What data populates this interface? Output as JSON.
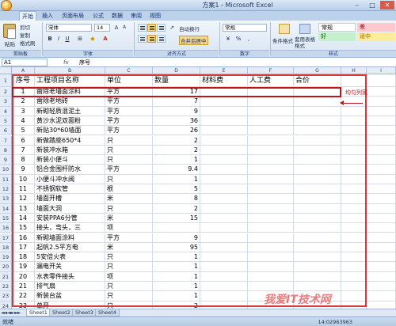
{
  "window": {
    "title": "方案1 - Microsoft Excel"
  },
  "ribbon_tabs": [
    "开始",
    "插入",
    "页面布局",
    "公式",
    "数据",
    "审阅",
    "视图"
  ],
  "clipboard": {
    "paste": "粘贴",
    "cut": "剪切",
    "copy": "复制",
    "format_painter": "格式刷",
    "label": "剪贴板"
  },
  "font": {
    "name": "宋体",
    "size": "14",
    "label": "字体"
  },
  "alignment": {
    "wrap": "自动换行",
    "merge": "合并后居中",
    "label": "对齐方式"
  },
  "number": {
    "format": "常规",
    "label": "数字"
  },
  "styles": {
    "conditional": "条件格式",
    "table": "套用表格格式",
    "normal": "常规",
    "bad": "差",
    "good": "好",
    "neutral": "适中",
    "label": "样式"
  },
  "formula_bar": {
    "name_box": "A1",
    "fx": "fx",
    "content": "序号"
  },
  "columns": [
    "A",
    "B",
    "C",
    "D",
    "E",
    "F",
    "G",
    "H",
    "I"
  ],
  "table": {
    "headers": [
      "序号",
      "工程项目名称",
      "单位",
      "数量",
      "材料费",
      "人工费",
      "合价"
    ],
    "rows": [
      [
        "1",
        "凿除老墙面涂料",
        "平方",
        "17"
      ],
      [
        "2",
        "凿除老地砖",
        "平方",
        "7"
      ],
      [
        "3",
        "新砌轻质混泥土",
        "平方",
        "9"
      ],
      [
        "4",
        "黄沙水泥双面粉",
        "平方",
        "36"
      ],
      [
        "5",
        "新贴30*60墙面",
        "平方",
        "26"
      ],
      [
        "6",
        "新做踏座650*4",
        "只",
        "2"
      ],
      [
        "7",
        "新装冲水箱",
        "只",
        "2"
      ],
      [
        "8",
        "新装小便斗",
        "只",
        "1"
      ],
      [
        "9",
        "铝合金围杆防水",
        "平方",
        "9.4"
      ],
      [
        "10",
        "小便斗冲水阀",
        "只",
        "1"
      ],
      [
        "11",
        "不锈钢软管",
        "根",
        "5"
      ],
      [
        "12",
        "墙面开槽",
        "米",
        "8"
      ],
      [
        "13",
        "墙面大洞",
        "只",
        "2"
      ],
      [
        "14",
        "安装PPA6分管",
        "米",
        "15"
      ],
      [
        "15",
        "接头，弯头，三",
        "项",
        ""
      ],
      [
        "16",
        "新砌墙面涂料",
        "平方",
        "9"
      ],
      [
        "17",
        "起帆2.5平方电",
        "米",
        "95"
      ],
      [
        "18",
        "5安倍火表",
        "只",
        "1"
      ],
      [
        "19",
        "漏电开关",
        "只",
        "1"
      ],
      [
        "20",
        "水表零件接头",
        "项",
        "1"
      ],
      [
        "21",
        "排气扇",
        "只",
        "1"
      ],
      [
        "22",
        "新装台盆",
        "只",
        "1"
      ],
      [
        "23",
        "单开",
        "只",
        "2"
      ]
    ],
    "row_numbers": [
      "1",
      "2",
      "3",
      "4",
      "5",
      "6",
      "7",
      "8",
      "9",
      "10",
      "11",
      "12",
      "13",
      "14",
      "15",
      "16",
      "17",
      "18",
      "19",
      "20",
      "21",
      "22",
      "23",
      "24"
    ]
  },
  "annotation": "均匀列宽",
  "sheets": [
    "Sheet1",
    "Sheet2",
    "Sheet3",
    "Sheet4"
  ],
  "status": {
    "ready": "就绪",
    "datetime": "14:02963963"
  },
  "watermark": "我爱IT技术网",
  "colors": {
    "annotation": "#c0141e",
    "bad_fill": "#ffc7ce",
    "good_fill": "#c6efce",
    "neutral_fill": "#ffeb9c"
  }
}
